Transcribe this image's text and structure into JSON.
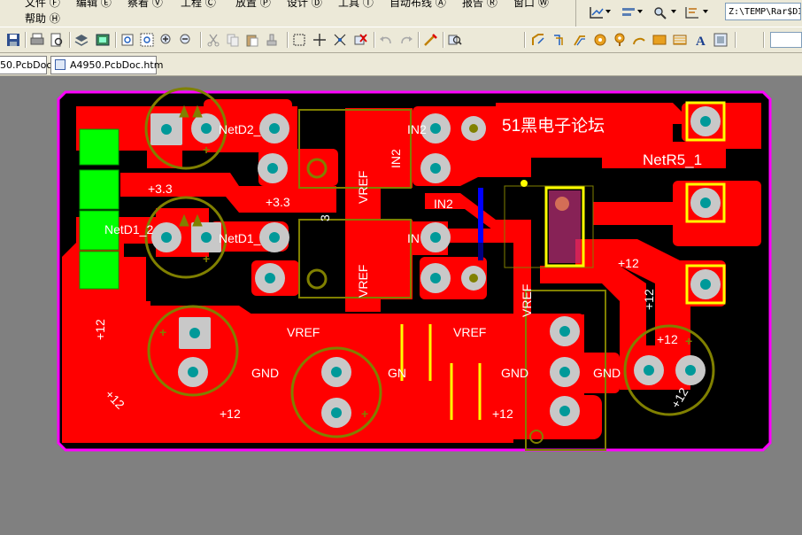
{
  "menu": {
    "items": [
      "文件 Ⓕ",
      "编辑 Ⓔ",
      "察看 Ⓥ",
      "工程 Ⓒ",
      "放置 Ⓟ",
      "设计 Ⓓ",
      "工具 Ⓣ",
      "自动布线 Ⓐ",
      "报告 Ⓡ",
      "窗口 Ⓦ"
    ],
    "help": "帮助 Ⓗ"
  },
  "path_field": "Z:\\TEMP\\Rar$DI",
  "tabs": [
    {
      "label": "50.PcbDoc"
    },
    {
      "label": "A4950.PcbDoc.htm"
    }
  ],
  "colors": {
    "board_fill": "#ff0000",
    "board_outline": "#ff00ff",
    "board_background": "#000000",
    "overlay": "#808000",
    "pad_green": "#00ff00",
    "hole": "#009999",
    "highlight": "#ffff00",
    "workspace": "#808080"
  },
  "board": {
    "watermark": "51黑电子论坛",
    "labels": {
      "netd2": "NetD2_",
      "netd1a": "NetD1_2",
      "netd1b": "NetD1_",
      "netr5": "NetR5_1",
      "p33a": "+3.3",
      "p33b": "+3.3",
      "p33c": "3",
      "in2a": "IN2",
      "in2b": "IN2",
      "in2c": "IN2",
      "in1": "IN",
      "vref1": "VREF",
      "vref2": "VREF",
      "vref3": "VREF",
      "vref4": "VREF",
      "vref5": "VREF",
      "gnd1": "GND",
      "gnd2": "GN",
      "gnd3": "GND",
      "gnd4": "GND",
      "p12a": "+12",
      "p12b": "+12",
      "p12c": "+12",
      "p12d": "+12",
      "p12e": "+12",
      "p12f": "+12",
      "p12g": "+12",
      "p12h": "+12",
      "plus": "+"
    }
  }
}
